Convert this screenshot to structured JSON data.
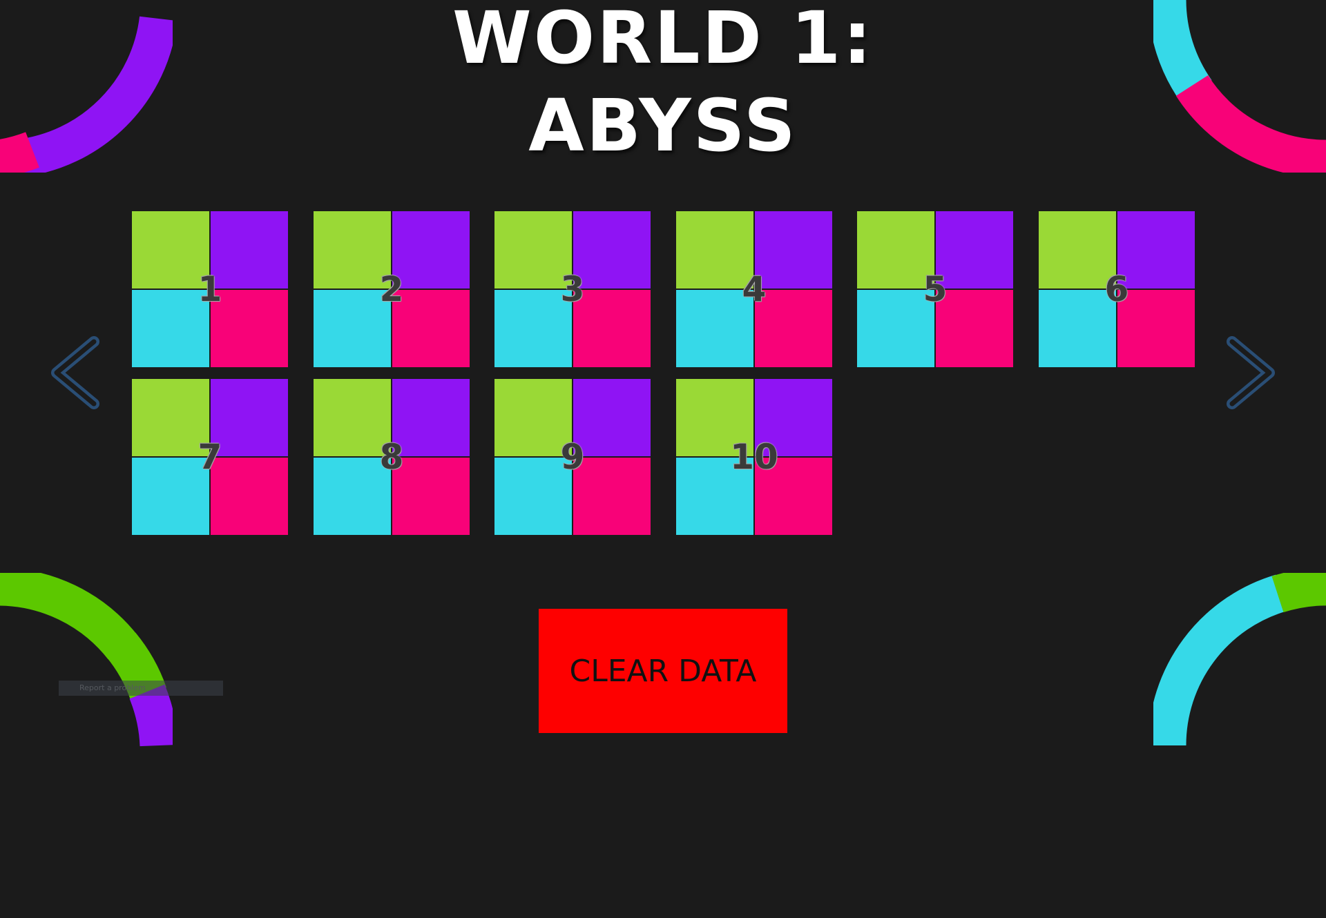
{
  "title": {
    "line1": "WORLD 1:",
    "line2": "ABYSS"
  },
  "colors": {
    "background": "#1b1b1b",
    "green": "#9ad936",
    "purple": "#8f14f4",
    "cyan": "#36d9e8",
    "pink": "#f80278",
    "arc_green": "#5cc800",
    "clear_button": "#fe0000",
    "arrow_outline": "#2a4e75"
  },
  "levels": [
    {
      "number": "1"
    },
    {
      "number": "2"
    },
    {
      "number": "3"
    },
    {
      "number": "4"
    },
    {
      "number": "5"
    },
    {
      "number": "6"
    },
    {
      "number": "7"
    },
    {
      "number": "8"
    },
    {
      "number": "9"
    },
    {
      "number": "10"
    }
  ],
  "navigation": {
    "prev_icon": "chevron-left-icon",
    "next_icon": "chevron-right-icon"
  },
  "clear_button": {
    "label": "CLEAR DATA"
  },
  "overlay": {
    "report_text": "Report a problem"
  }
}
